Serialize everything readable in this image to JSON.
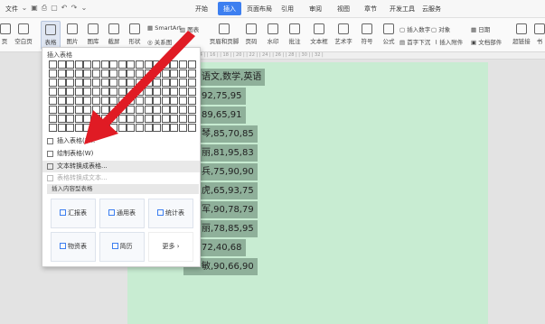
{
  "app": {
    "file_menu": "文件",
    "quick_access": [
      "save-icon",
      "print-icon",
      "preview-icon",
      "undo-icon",
      "redo-icon",
      "more-icon"
    ],
    "tabs": [
      "开始",
      "插入",
      "页面布局",
      "引用",
      "审阅",
      "视图",
      "章节",
      "开发工具",
      "云服务"
    ],
    "active_tab": "插入"
  },
  "ribbon": {
    "page_label": "页",
    "blank_page": "空白页",
    "table": "表格",
    "picture": "图片",
    "library": "图库",
    "screenshot": "截屏",
    "shape": "形状",
    "smartart": "SmartArt",
    "chart": "图表",
    "relation": "关系图",
    "header_footer": "页眉和页脚",
    "page_number": "页码",
    "watermark": "水印",
    "comment": "批注",
    "textbox": "文本框",
    "wordart": "艺术字",
    "symbol": "符号",
    "formula": "公式",
    "insert_number": "插入数字",
    "object": "对象",
    "date": "日期",
    "first_drop": "首字下沉",
    "attachment": "插入附件",
    "doc_parts": "文档部件",
    "hyperlink": "超链接",
    "bookmark": "书"
  },
  "ruler": "| 2 |   | 4 |   | 6 |   | 8 |   | 10 |   | 12 |   | 14 |   | 16 |   | 18 |   | 20 |   | 22 |   | 24 |   | 26 |   | 28 |   | 30 |   | 32 |",
  "document": {
    "lines": [
      "语文,数学,英语",
      "92,75,95",
      "89,65,91",
      "琴,85,70,85",
      "丽,81,95,83",
      "兵,75,90,90",
      "虎,65,93,75",
      "军,90,78,79",
      "丽,78,85,95",
      "72,40,68",
      "敏,90,66,90"
    ]
  },
  "table_panel": {
    "title": "插入表格",
    "grid_cols": 17,
    "grid_rows": 8,
    "menu": {
      "insert_table": "插入表格(I)...",
      "draw_table": "绘制表格(W)",
      "text_to_table": "文本转换成表格...",
      "table_to_text": "表格转换成文本..."
    },
    "section": "插入内容型表格",
    "templates": [
      {
        "label": "汇报表",
        "icon": "report-icon"
      },
      {
        "label": "通用表",
        "icon": "general-table-icon"
      },
      {
        "label": "统计表",
        "icon": "statistics-icon"
      },
      {
        "label": "物资表",
        "icon": "materials-icon"
      },
      {
        "label": "简历",
        "icon": "resume-icon"
      },
      {
        "label": "更多",
        "icon": "chevron-right-icon"
      }
    ]
  },
  "colors": {
    "accent": "#3d7ff0",
    "page_bg": "#c8ecd2",
    "highlight": "#8fb09a",
    "arrow": "#e01b24"
  }
}
